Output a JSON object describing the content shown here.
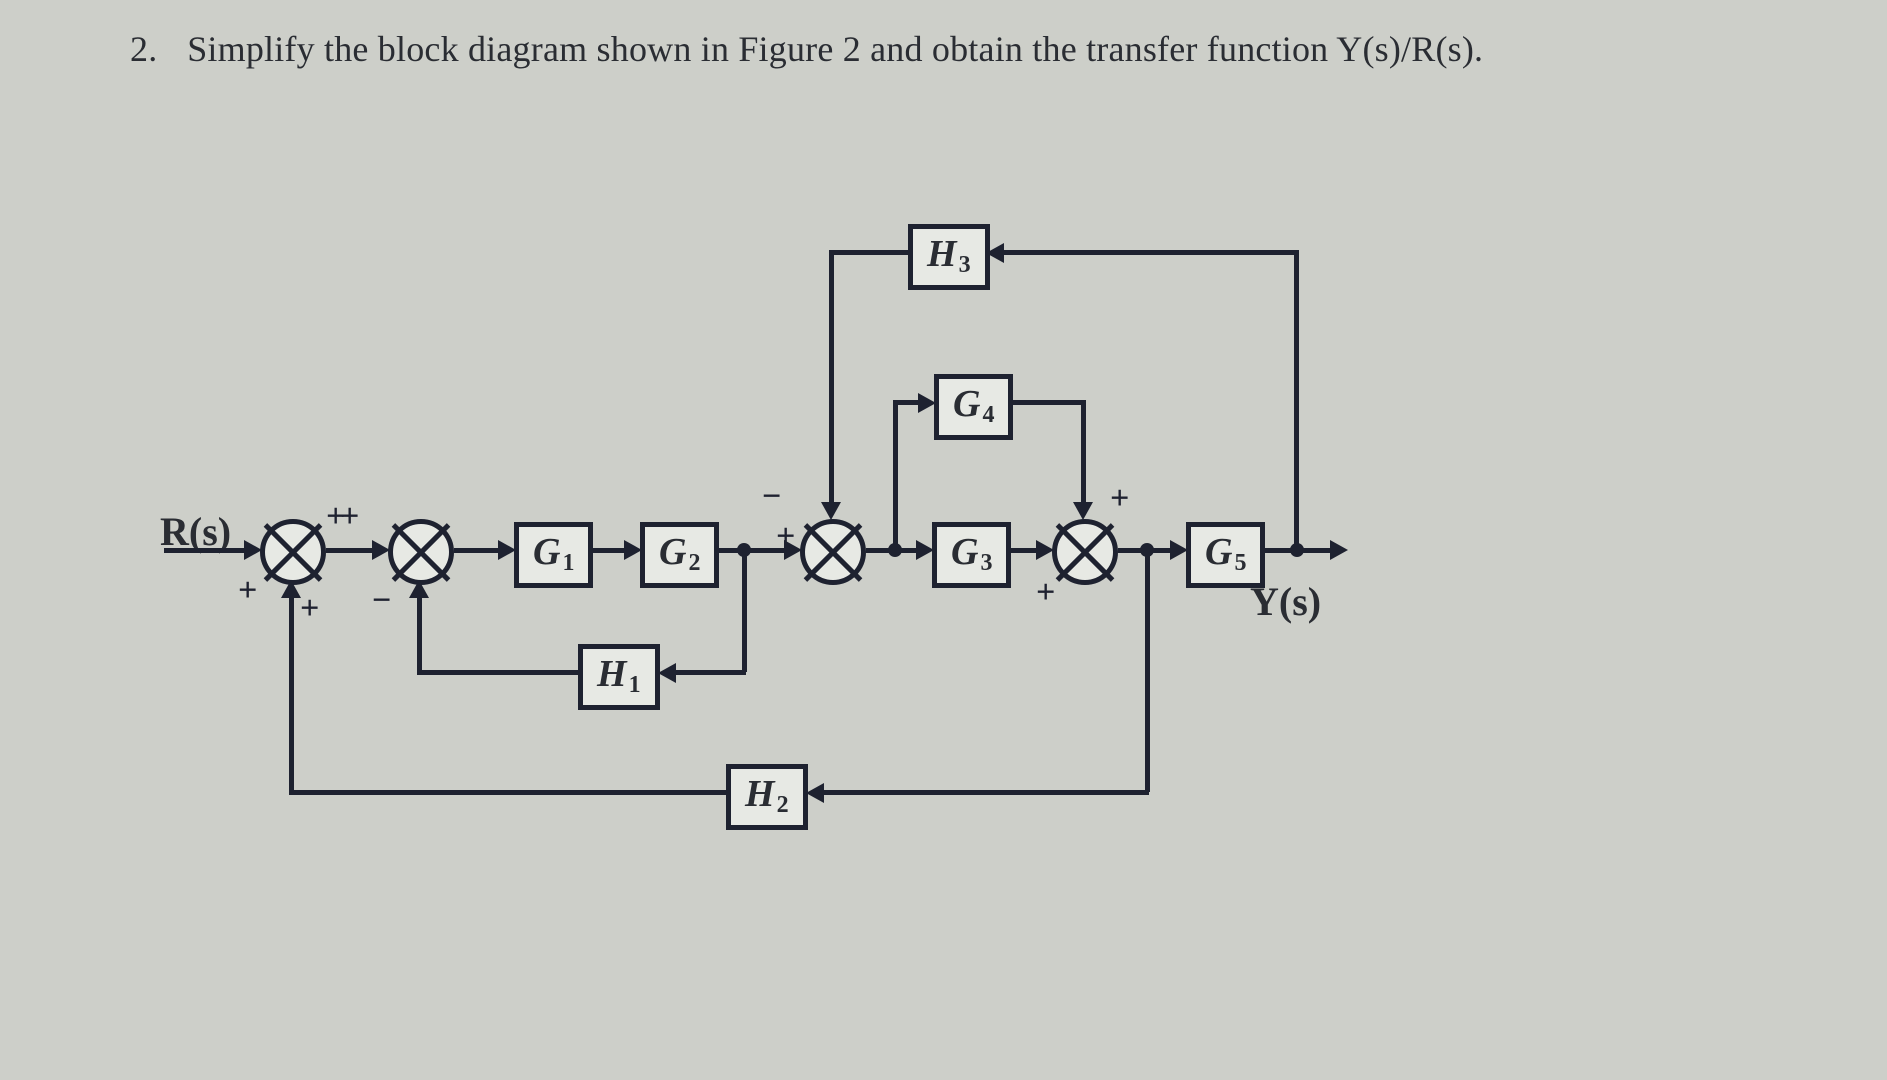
{
  "question": {
    "number": "2.",
    "text": "Simplify the block diagram shown in Figure 2 and obtain the transfer function Y(s)/R(s)."
  },
  "diagram": {
    "input_label": "R(s)",
    "output_label": "Y(s)",
    "blocks": {
      "G1": {
        "base": "G",
        "sub": "1"
      },
      "G2": {
        "base": "G",
        "sub": "2"
      },
      "G3": {
        "base": "G",
        "sub": "3"
      },
      "G4": {
        "base": "G",
        "sub": "4"
      },
      "G5": {
        "base": "G",
        "sub": "5"
      },
      "H1": {
        "base": "H",
        "sub": "1"
      },
      "H2": {
        "base": "H",
        "sub": "2"
      },
      "H3": {
        "base": "H",
        "sub": "3"
      }
    },
    "sum_signs": {
      "s1": {
        "top_right": "+",
        "bottom_left": "+",
        "bottom_right": "+"
      },
      "s2": {
        "top_right": "+",
        "bottom_left": "−"
      },
      "s3": {
        "top_left": "−",
        "bottom_left": "+"
      },
      "s4": {
        "top_right": "+",
        "bottom_left": "+"
      }
    }
  }
}
